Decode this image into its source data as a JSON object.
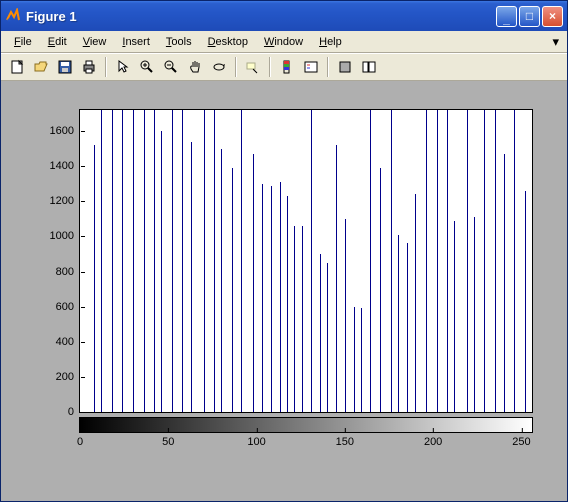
{
  "titlebar": {
    "title": "Figure 1"
  },
  "winbtns": {
    "min": "_",
    "max": "□",
    "close": "×"
  },
  "menu": {
    "file": "File",
    "edit": "Edit",
    "view": "View",
    "insert": "Insert",
    "tools": "Tools",
    "desktop": "Desktop",
    "window": "Window",
    "help": "Help",
    "dock": "▾"
  },
  "chart_data": {
    "type": "bar",
    "title": "",
    "xlabel": "",
    "ylabel": "",
    "xlim": [
      0,
      256
    ],
    "ylim": [
      0,
      1720
    ],
    "yticks": [
      0,
      200,
      400,
      600,
      800,
      1000,
      1200,
      1400,
      1600
    ],
    "xticks": [
      0,
      50,
      100,
      150,
      200,
      250
    ],
    "colorbar_ticks": [
      0,
      50,
      100,
      150,
      200,
      250
    ],
    "series": [
      {
        "x": 8,
        "y": 1520
      },
      {
        "x": 12,
        "y": 1720
      },
      {
        "x": 18,
        "y": 1720
      },
      {
        "x": 24,
        "y": 1720
      },
      {
        "x": 30,
        "y": 1720
      },
      {
        "x": 36,
        "y": 1720
      },
      {
        "x": 42,
        "y": 1720
      },
      {
        "x": 46,
        "y": 1600
      },
      {
        "x": 52,
        "y": 1720
      },
      {
        "x": 58,
        "y": 1720
      },
      {
        "x": 63,
        "y": 1540
      },
      {
        "x": 70,
        "y": 1720
      },
      {
        "x": 76,
        "y": 1720
      },
      {
        "x": 80,
        "y": 1500
      },
      {
        "x": 86,
        "y": 1390
      },
      {
        "x": 91,
        "y": 1720
      },
      {
        "x": 98,
        "y": 1470
      },
      {
        "x": 103,
        "y": 1300
      },
      {
        "x": 108,
        "y": 1290
      },
      {
        "x": 113,
        "y": 1310
      },
      {
        "x": 117,
        "y": 1230
      },
      {
        "x": 121,
        "y": 1060
      },
      {
        "x": 126,
        "y": 1060
      },
      {
        "x": 131,
        "y": 1720
      },
      {
        "x": 136,
        "y": 900
      },
      {
        "x": 140,
        "y": 850
      },
      {
        "x": 145,
        "y": 1520
      },
      {
        "x": 150,
        "y": 1100
      },
      {
        "x": 155,
        "y": 600
      },
      {
        "x": 159,
        "y": 590
      },
      {
        "x": 164,
        "y": 1720
      },
      {
        "x": 170,
        "y": 1390
      },
      {
        "x": 176,
        "y": 1720
      },
      {
        "x": 180,
        "y": 1010
      },
      {
        "x": 185,
        "y": 960
      },
      {
        "x": 190,
        "y": 1240
      },
      {
        "x": 196,
        "y": 1720
      },
      {
        "x": 202,
        "y": 1720
      },
      {
        "x": 208,
        "y": 1720
      },
      {
        "x": 212,
        "y": 1090
      },
      {
        "x": 219,
        "y": 1720
      },
      {
        "x": 223,
        "y": 1110
      },
      {
        "x": 229,
        "y": 1720
      },
      {
        "x": 235,
        "y": 1720
      },
      {
        "x": 240,
        "y": 1470
      },
      {
        "x": 246,
        "y": 1720
      },
      {
        "x": 252,
        "y": 1260
      }
    ]
  }
}
